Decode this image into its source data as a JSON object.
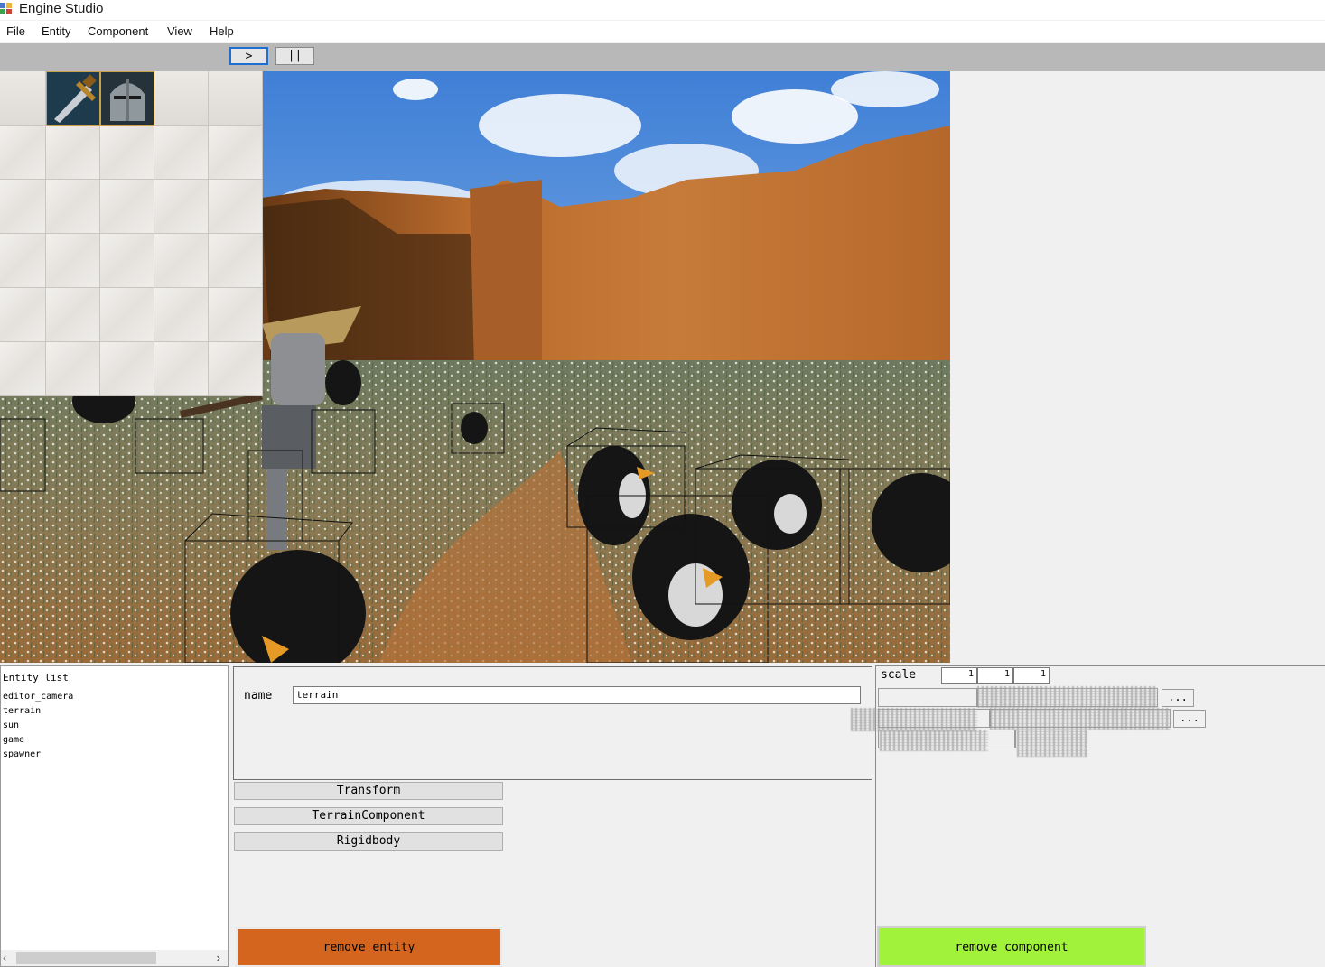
{
  "window": {
    "title": "Engine Studio"
  },
  "menu": {
    "items": [
      "File",
      "Entity",
      "Component",
      "View",
      "Help"
    ]
  },
  "toolbar": {
    "play_label": ">",
    "pause_label": "||"
  },
  "inventory": {
    "items": [
      "sword-icon",
      "knight-helmet-icon"
    ]
  },
  "entity_list": {
    "title": "Entity list",
    "items": [
      "editor_camera",
      "terrain",
      "sun",
      "game",
      "spawner"
    ]
  },
  "entity": {
    "name_label": "name",
    "name_value": "terrain"
  },
  "components": [
    "Transform",
    "TerrainComponent",
    "Rigidbody"
  ],
  "buttons": {
    "remove_entity": "remove entity",
    "remove_component": "remove component"
  },
  "properties": {
    "scale_label": "scale",
    "scale_values": [
      "1",
      "1",
      "1"
    ],
    "browse_label": "..."
  },
  "colors": {
    "remove_entity": "#d4651f",
    "remove_component": "#a1f23a",
    "play_border": "#1f6fd1"
  }
}
